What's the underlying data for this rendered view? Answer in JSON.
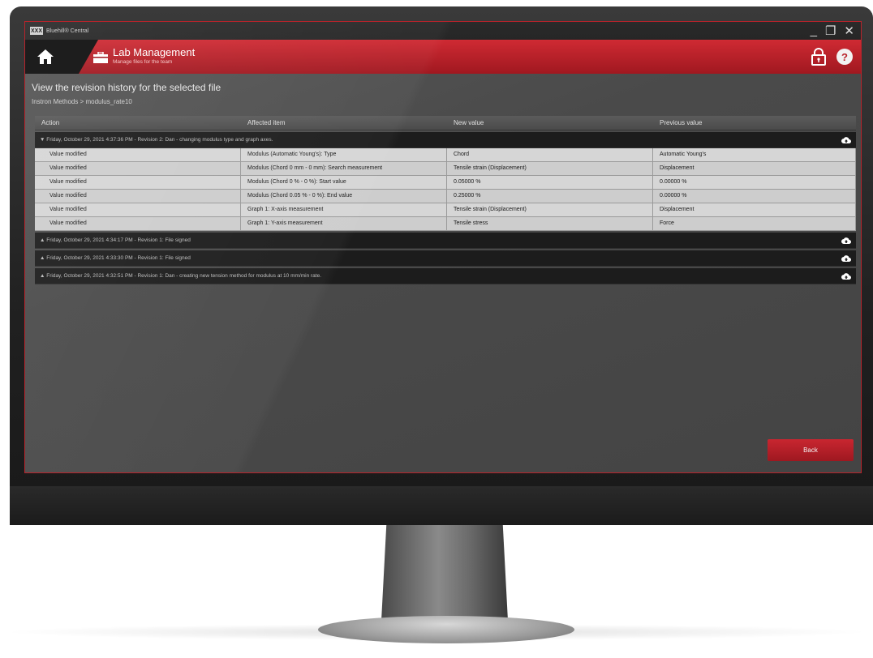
{
  "app": {
    "title": "Bluehill® Central",
    "logo_text": "XXX"
  },
  "window_controls": {
    "minimize": "_",
    "restore": "❐",
    "close": "✕"
  },
  "header": {
    "title": "Lab Management",
    "subtitle": "Manage files for the team",
    "help": "?"
  },
  "page": {
    "heading": "View the revision history for the selected file",
    "breadcrumb": "Instron Methods > modulus_rate10"
  },
  "table": {
    "columns": [
      "Action",
      "Affected item",
      "New value",
      "Previous value"
    ],
    "groups": [
      {
        "label": "Friday, October 29, 2021 4:37:36 PM - Revision 2: Dan - changing modulus type and graph axes.",
        "expanded": true,
        "rows": [
          [
            "Value modified",
            "Modulus (Automatic Young's): Type",
            "Chord",
            "Automatic Young's"
          ],
          [
            "Value modified",
            "Modulus (Chord 0 mm - 0 mm): Search measurement",
            "Tensile strain (Displacement)",
            "Displacement"
          ],
          [
            "Value modified",
            "Modulus (Chord 0 % - 0 %): Start value",
            "0.05000 %",
            "0.00000 %"
          ],
          [
            "Value modified",
            "Modulus (Chord 0.05 % - 0 %): End value",
            "0.25000 %",
            "0.00000 %"
          ],
          [
            "Value modified",
            "Graph 1: X-axis measurement",
            "Tensile strain (Displacement)",
            "Displacement"
          ],
          [
            "Value modified",
            "Graph 1: Y-axis measurement",
            "Tensile stress",
            "Force"
          ]
        ]
      },
      {
        "label": "Friday, October 29, 2021 4:34:17 PM - Revision 1: File signed",
        "expanded": false,
        "rows": []
      },
      {
        "label": "Friday, October 29, 2021 4:33:30 PM - Revision 1: File signed",
        "expanded": false,
        "rows": []
      },
      {
        "label": "Friday, October 29, 2021 4:32:51 PM - Revision 1: Dan - creating new tension method for modulus at 10 mm/min rate.",
        "expanded": false,
        "rows": []
      }
    ]
  },
  "footer": {
    "back_label": "Back"
  },
  "colors": {
    "accent": "#b8232b",
    "header_red": "#cf2a33",
    "group_bg": "#1c1c1c",
    "row_bg": "#d6d6d6"
  },
  "icons": {
    "home": "home-icon",
    "section": "briefcase-icon",
    "lock": "lock-icon",
    "help": "help-icon",
    "cloud": "cloud-upload-icon"
  }
}
